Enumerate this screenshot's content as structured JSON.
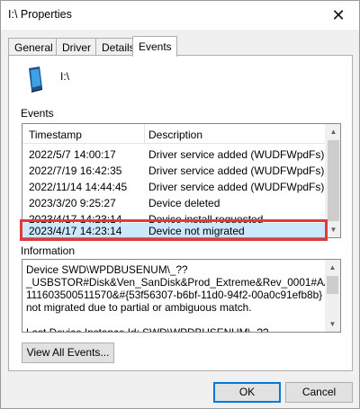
{
  "window": {
    "title": "I:\\ Properties",
    "close_glyph": "✕"
  },
  "tabs": [
    {
      "label": "General",
      "active": false
    },
    {
      "label": "Driver",
      "active": false
    },
    {
      "label": "Details",
      "active": false
    },
    {
      "label": "Events",
      "active": true
    }
  ],
  "device": {
    "name": "I:\\",
    "icon": "portable-device-icon"
  },
  "events": {
    "section_label": "Events",
    "columns": {
      "timestamp": "Timestamp",
      "description": "Description"
    },
    "rows": [
      {
        "timestamp": "2022/5/7 14:00:17",
        "description": "Driver service added (WUDFWpdFs)"
      },
      {
        "timestamp": "2022/7/19 16:42:35",
        "description": "Driver service added (WUDFWpdFs)"
      },
      {
        "timestamp": "2022/11/14 14:44:45",
        "description": "Driver service added (WUDFWpdFs)"
      },
      {
        "timestamp": "2023/3/20 9:25:27",
        "description": "Device deleted"
      },
      {
        "timestamp": "2023/4/17 14:23:14",
        "description": "Device install requested"
      },
      {
        "timestamp": "2023/4/17 14:23:14",
        "description": "Device not migrated",
        "selected": true
      }
    ],
    "highlight_color": "#e03a3a",
    "selection_color": "#cce8ff"
  },
  "information": {
    "section_label": "Information",
    "text": "Device SWD\\WPDBUSENUM\\_??\n_USBSTOR#Disk&Ven_SanDisk&Prod_Extreme&Rev_0001#AA0103\n111603500511570&#{53f56307-b6bf-11d0-94f2-00a0c91efb8b} was\nnot migrated due to partial or ambiguous match.\n\nLast Device Instance Id: SWD\\WPDBUSENUM\\_??"
  },
  "buttons": {
    "view_all": "View All Events...",
    "ok": "OK",
    "cancel": "Cancel"
  }
}
